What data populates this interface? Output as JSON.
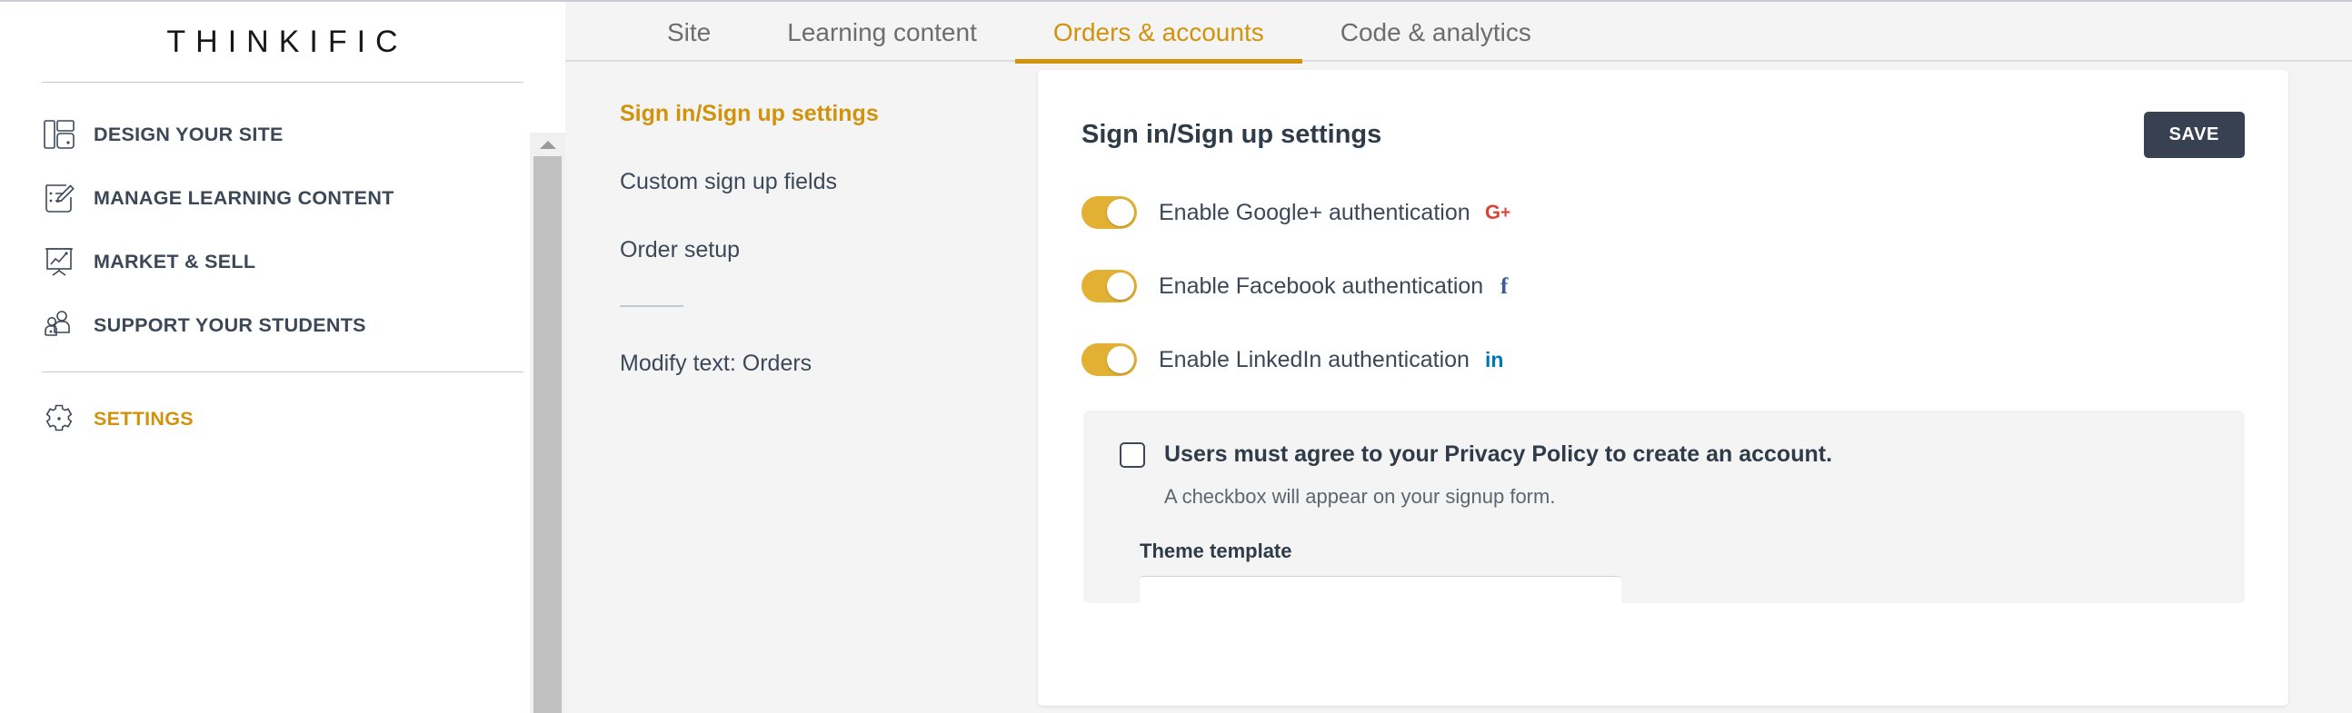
{
  "sidebar": {
    "brand": "THINKIFIC",
    "items": [
      {
        "label": "DESIGN YOUR SITE",
        "icon": "layout-icon",
        "active": false
      },
      {
        "label": "MANAGE LEARNING CONTENT",
        "icon": "edit-document-icon",
        "active": false
      },
      {
        "label": "MARKET & SELL",
        "icon": "presentation-chart-icon",
        "active": false
      },
      {
        "label": "SUPPORT YOUR STUDENTS",
        "icon": "people-icon",
        "active": false
      },
      {
        "label": "SETTINGS",
        "icon": "gear-icon",
        "active": true
      }
    ]
  },
  "tabs": [
    {
      "label": "Site",
      "active": false
    },
    {
      "label": "Learning content",
      "active": false
    },
    {
      "label": "Orders & accounts",
      "active": true
    },
    {
      "label": "Code & analytics",
      "active": false
    }
  ],
  "subnav": {
    "items": [
      {
        "label": "Sign in/Sign up settings",
        "active": true
      },
      {
        "label": "Custom sign up fields",
        "active": false
      },
      {
        "label": "Order setup",
        "active": false
      }
    ],
    "items_after_rule": [
      {
        "label": "Modify text: Orders",
        "active": false
      }
    ]
  },
  "main": {
    "title": "Sign in/Sign up settings",
    "save_label": "SAVE",
    "toggles": [
      {
        "label": "Enable Google+ authentication",
        "on": true,
        "brand_icon": "google-plus-icon",
        "brand_text": "G+",
        "color": "#db4437"
      },
      {
        "label": "Enable Facebook authentication",
        "on": true,
        "brand_icon": "facebook-icon",
        "brand_text": "f",
        "color": "#3b5998"
      },
      {
        "label": "Enable LinkedIn authentication",
        "on": true,
        "brand_icon": "linkedin-icon",
        "brand_text": "in",
        "color": "#0077b5"
      }
    ],
    "privacy": {
      "checkbox_label": "Users must agree to your Privacy Policy to create an account.",
      "checked": false,
      "help_text": "A checkbox will appear on your signup form.",
      "theme_template_label": "Theme template"
    }
  },
  "colors": {
    "accent_gold": "#d1930c",
    "toggle_gold": "#e2b133",
    "dark_slate": "#374151",
    "text_slate": "#3c4858",
    "page_bg": "#f4f4f4"
  }
}
